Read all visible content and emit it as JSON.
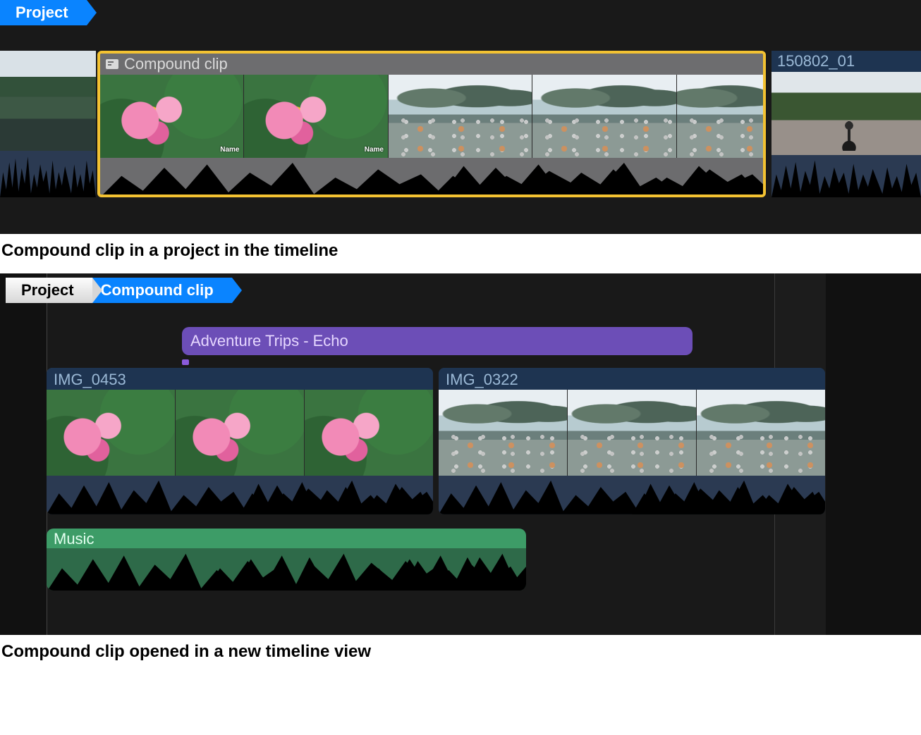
{
  "panel1": {
    "breadcrumb": [
      "Project"
    ],
    "compound_clip_label": "Compound clip",
    "right_clip_label": "150802_01"
  },
  "caption1": "Compound clip in a project in the timeline",
  "panel2": {
    "breadcrumb": [
      "Project",
      "Compound clip"
    ],
    "title_clip": "Adventure Trips - Echo",
    "clip_left": "IMG_0453",
    "clip_right": "IMG_0322",
    "music": "Music"
  },
  "caption2": "Compound clip opened in a new timeline view"
}
